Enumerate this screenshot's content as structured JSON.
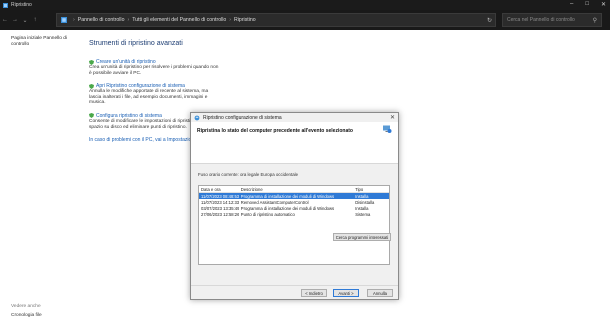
{
  "window": {
    "title": "Ripristino"
  },
  "nav": {
    "breadcrumb": [
      "Pannello di controllo",
      "Tutti gli elementi del Pannello di controllo",
      "Ripristino"
    ],
    "search_placeholder": "Cerca nel Pannello di controllo"
  },
  "sidebar": {
    "home_link": "Pagina iniziale Pannello di controllo",
    "see_also_label": "Vedere anche",
    "file_history": "Cronologia file"
  },
  "main": {
    "heading": "Strumenti di ripristino avanzati",
    "tools": [
      {
        "link": "Creare un'unità di ripristino",
        "desc": "Crea un'unità di ripristino per risolvere i problemi quando non è possibile avviare il PC."
      },
      {
        "link": "Apri Ripristino configurazione di sistema",
        "desc": "Annulla le modifiche apportate di recente al sistema, ma lascia inalterati i file, ad esempio documenti, immagini e musica."
      },
      {
        "link": "Configura ripristino di sistema",
        "desc": "Consente di modificare le impostazioni di ripristino, gestire lo spazio su disco ed eliminare punti di ripristino."
      }
    ],
    "bottom_link": "In caso di problemi con il PC, vai a Impostazioni"
  },
  "dialog": {
    "title": "Ripristino configurazione di sistema",
    "heading": "Ripristina lo stato del computer precedente all'evento selezionato",
    "timezone": "Fuso orario corrente: ora legale Europa occidentale",
    "columns": [
      "Data e ora",
      "Descrizione",
      "Tipo"
    ],
    "rows": [
      {
        "date": "11/07/2023 08:48:53",
        "desc": "Programma di installazione dei moduli di Windows",
        "type": "Installa"
      },
      {
        "date": "11/07/2023 14:12:33",
        "desc": "Removed AssistantComputerControl",
        "type": "Disinstalla"
      },
      {
        "date": "03/07/2023 13:35:49",
        "desc": "Programma di installazione dei moduli di Windows",
        "type": "Installa"
      },
      {
        "date": "27/06/2023 12:58:26",
        "desc": "Punto di ripristino automatico",
        "type": "Sistema"
      }
    ],
    "scan_button": "Cerca programmi interessati",
    "back_button": "< Indietro",
    "next_button": "Avanti >",
    "cancel_button": "Annulla"
  }
}
